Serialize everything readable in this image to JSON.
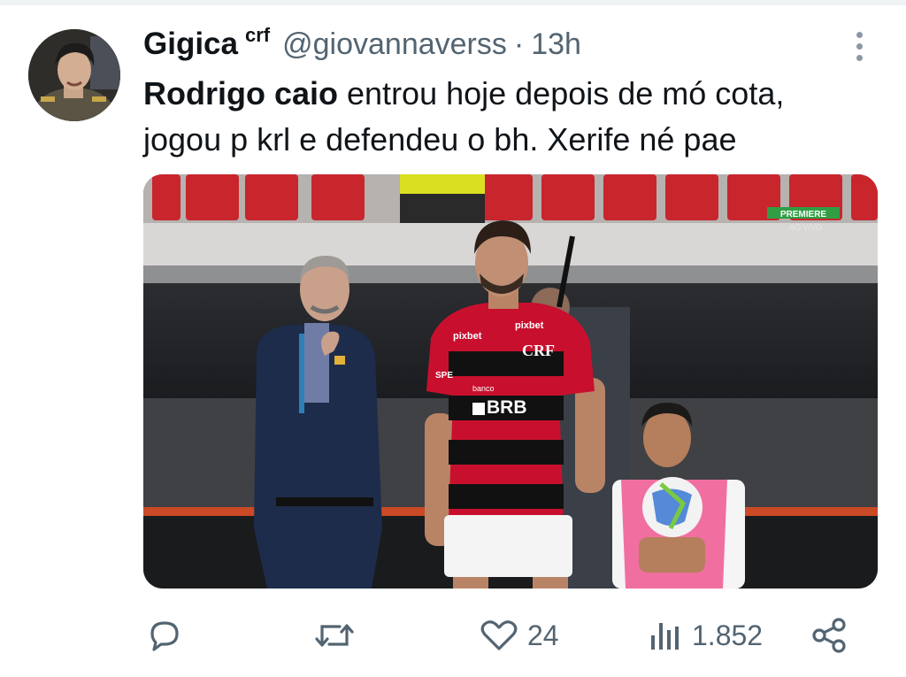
{
  "tweet": {
    "author_name": "Gigica",
    "author_badge": "crf",
    "handle": "@giovannaverss",
    "separator": "·",
    "time": "13h",
    "text_bold": "Rodrigo caio",
    "text_line1_rest": " entrou hoje depois de mó cota,",
    "text_line2": "jogou p krl e defendeu o bh. Xerife né pae"
  },
  "media": {
    "broadcaster": "PREMIERE",
    "live_label": "AO VIVO",
    "jersey_sponsor_1": "pixbet",
    "jersey_sponsor_2": "pixbet",
    "jersey_bank_small": "banco",
    "jersey_bank": "BRB",
    "jersey_crest": "CRF",
    "jersey_sleeve": "SPE"
  },
  "actions": {
    "reply_count": "",
    "retweet_count": "",
    "like_count": "24",
    "views_count": "1.852"
  },
  "colors": {
    "text": "#0f1419",
    "secondary": "#536471",
    "flamengo_red": "#c8102e",
    "bib_pink": "#f06fa0"
  },
  "icons": [
    "reply-icon",
    "retweet-icon",
    "like-icon",
    "views-icon",
    "share-icon",
    "more-icon"
  ]
}
